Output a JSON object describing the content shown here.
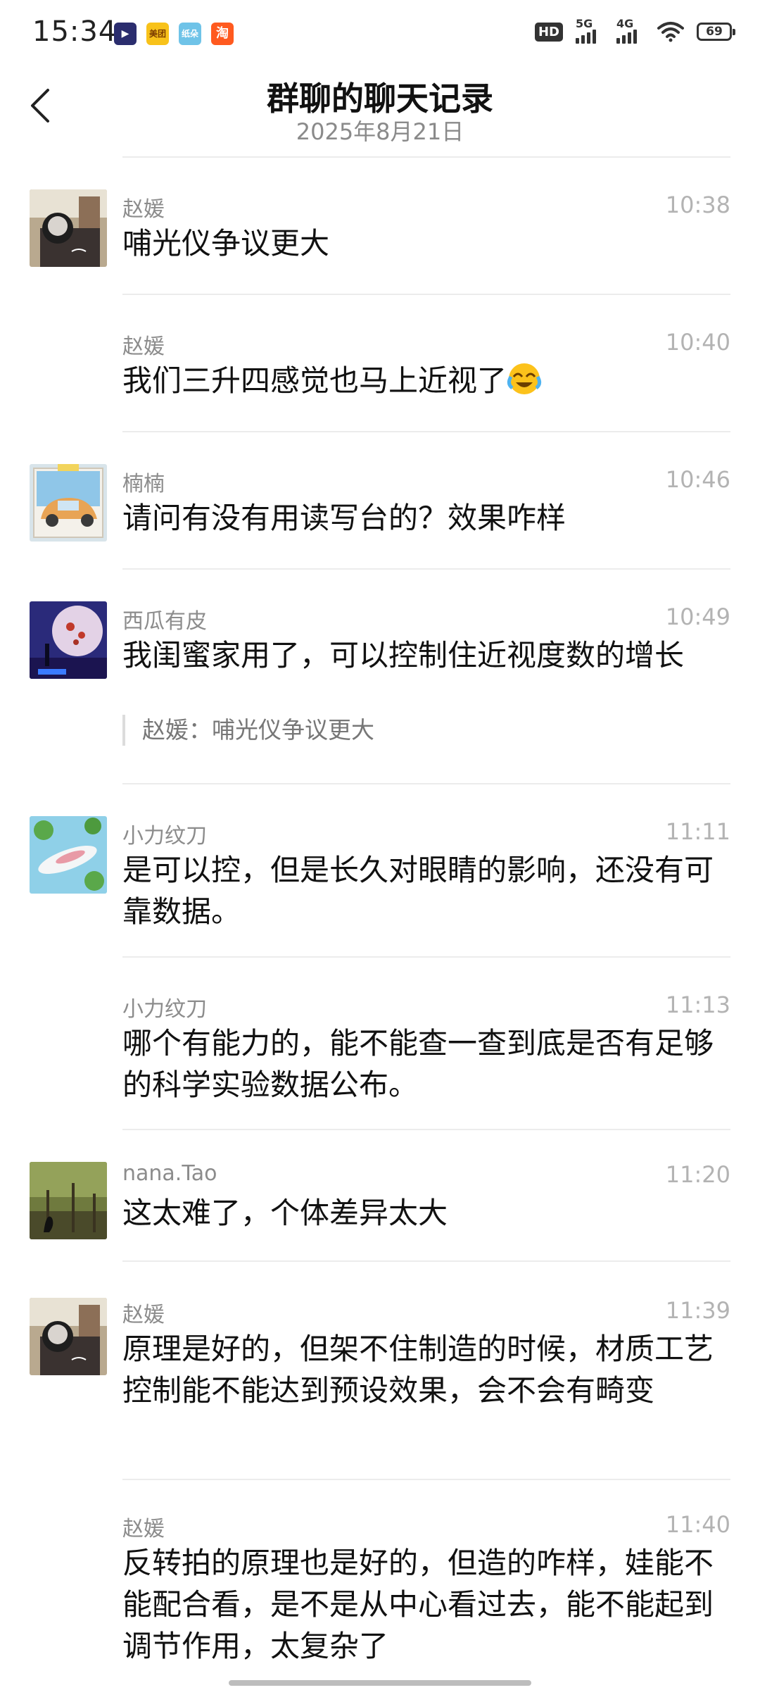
{
  "status_bar": {
    "time": "15:34",
    "apps": [
      {
        "icon": "video-app-icon",
        "label": "▶",
        "color": "#2b2d6e"
      },
      {
        "icon": "meituan-app-icon",
        "label": "美团",
        "color": "#f8c21a"
      },
      {
        "icon": "clouds-app-icon",
        "label": "纸朵",
        "color": "#6fc3e8"
      },
      {
        "icon": "taobao-app-icon",
        "label": "淘",
        "color": "#ff5a1f"
      }
    ],
    "hd": "HD",
    "network_1": "5G",
    "network_2": "4G",
    "battery": "69"
  },
  "header": {
    "title": "群聊的聊天记录",
    "date": "2025年8月21日"
  },
  "messages": [
    {
      "sender": "赵媛",
      "time": "10:38",
      "text": "哺光仪争议更大",
      "avatar": "avatar-zhaoyuan"
    },
    {
      "sender": "赵媛",
      "time": "10:40",
      "text": "我们三升四感觉也马上近视了"
    },
    {
      "sender": "楠楠",
      "time": "10:46",
      "text": "请问有没有用读写台的？效果咋样",
      "avatar": "avatar-nannan"
    },
    {
      "sender": "西瓜有皮",
      "time": "10:49",
      "text": "我闺蜜家用了，可以控制住近视度数的增长",
      "quote": "赵媛：哺光仪争议更大",
      "avatar": "avatar-xigua"
    },
    {
      "sender": "小力纹刀",
      "time": "11:11",
      "text": "是可以控，但是长久对眼睛的影响，还没有可靠数据。",
      "avatar": "avatar-xiaoli"
    },
    {
      "sender": "小力纹刀",
      "time": "11:13",
      "text": "哪个有能力的，能不能查一查到底是否有足够的科学实验数据公布。"
    },
    {
      "sender": "nana.Tao",
      "time": "11:20",
      "text": "这太难了，个体差异太大",
      "avatar": "avatar-nana"
    },
    {
      "sender": "赵媛",
      "time": "11:39",
      "text": "原理是好的，但架不住制造的时候，材质工艺控制能不能达到预设效果，会不会有畸变",
      "avatar": "avatar-zhaoyuan"
    },
    {
      "sender": "赵媛",
      "time": "11:40",
      "text": "反转拍的原理也是好的，但造的咋样，娃能不能配合看，是不是从中心看过去，能不能起到调节作用，太复杂了"
    }
  ]
}
